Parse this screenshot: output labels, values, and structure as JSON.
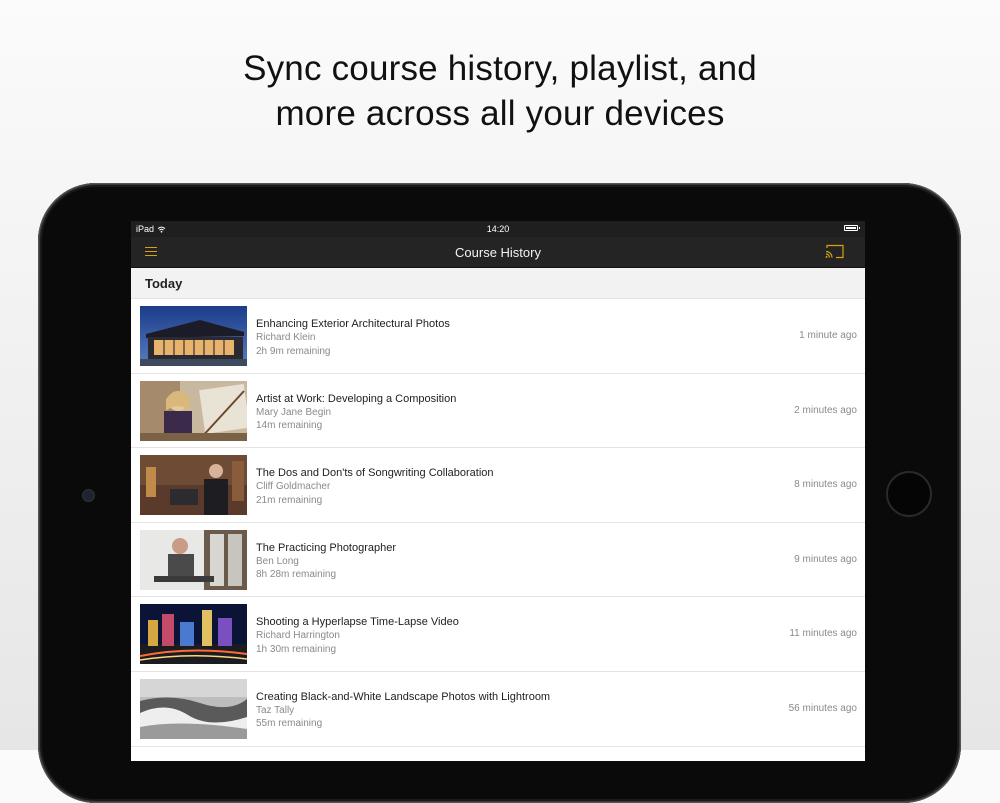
{
  "headline": {
    "line1": "Sync course history, playlist, and",
    "line2": "more across all your devices"
  },
  "status_bar": {
    "device": "iPad",
    "time": "14:20"
  },
  "nav": {
    "title": "Course History",
    "menu_icon": "hamburger-menu-icon",
    "cast_icon": "cast-icon",
    "accent_color": "#d7a20d"
  },
  "section": {
    "label": "Today"
  },
  "courses": [
    {
      "title": "Enhancing Exterior Architectural Photos",
      "author": "Richard Klein",
      "remaining": "2h 9m remaining",
      "time": "1 minute ago"
    },
    {
      "title": "Artist at Work: Developing a Composition",
      "author": "Mary Jane Begin",
      "remaining": "14m remaining",
      "time": "2 minutes ago"
    },
    {
      "title": "The Dos and Don'ts of Songwriting Collaboration",
      "author": "Cliff Goldmacher",
      "remaining": "21m remaining",
      "time": "8 minutes ago"
    },
    {
      "title": "The Practicing Photographer",
      "author": "Ben Long",
      "remaining": "8h 28m remaining",
      "time": "9 minutes ago"
    },
    {
      "title": "Shooting a Hyperlapse Time-Lapse Video",
      "author": "Richard Harrington",
      "remaining": "1h 30m remaining",
      "time": "11 minutes ago"
    },
    {
      "title": "Creating Black-and-White Landscape Photos with Lightroom",
      "author": "Taz Tally",
      "remaining": "55m remaining",
      "time": "56 minutes ago"
    }
  ]
}
